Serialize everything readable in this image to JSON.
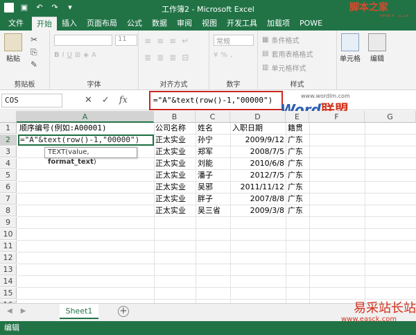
{
  "window": {
    "title": "工作簿2 - Microsoft Excel"
  },
  "watermarks": {
    "top_brand": "脚本之家",
    "top_url": "JB51.net",
    "word_url": "www.wordlm.com",
    "word_big": "Word",
    "word_big2": "联盟",
    "site": "易采站长站",
    "site_url": "www.easck.com"
  },
  "tabs": [
    "文件",
    "开始",
    "插入",
    "页面布局",
    "公式",
    "数据",
    "审阅",
    "视图",
    "开发工具",
    "加载项",
    "POWE"
  ],
  "ribbon": {
    "paste": "粘贴",
    "clipboard": "剪贴板",
    "font_size": "11",
    "font": "字体",
    "align": "对齐方式",
    "number_format": "常规",
    "number": "数字",
    "cond_format": "条件格式",
    "table_format": "套用表格格式",
    "cell_style": "单元格样式",
    "styles": "样式",
    "cells": "单元格",
    "edit": "编辑"
  },
  "formula_bar": {
    "name_box": "COS",
    "formula": "=\"A\"&text(row()-1,\"00000\")"
  },
  "columns": [
    "A",
    "B",
    "C",
    "D",
    "E",
    "F",
    "G"
  ],
  "rows": [
    "1",
    "2",
    "3",
    "4",
    "5",
    "6",
    "7",
    "8",
    "9",
    "10",
    "11",
    "12",
    "13",
    "14",
    "15",
    "16"
  ],
  "headers": {
    "a1": "顺序编号(例如:A00001)",
    "company": "公司名称",
    "name": "姓名",
    "date": "入职日期",
    "origin": "籍贯"
  },
  "data": [
    {
      "company": "正太实业",
      "name": "孙宁",
      "date": "2009/9/12",
      "origin": "广东"
    },
    {
      "company": "正太实业",
      "name": "郑军",
      "date": "2008/7/5",
      "origin": "广东"
    },
    {
      "company": "正太实业",
      "name": "刘能",
      "date": "2010/6/8",
      "origin": "广东"
    },
    {
      "company": "正太实业",
      "name": "潘子",
      "date": "2012/7/5",
      "origin": "广东"
    },
    {
      "company": "正太实业",
      "name": "吴邪",
      "date": "2011/11/12",
      "origin": "广东"
    },
    {
      "company": "正太实业",
      "name": "胖子",
      "date": "2007/8/8",
      "origin": "广东"
    },
    {
      "company": "正太实业",
      "name": "吴三省",
      "date": "2009/3/8",
      "origin": "广东"
    }
  ],
  "edit_cell": "=\"A\"&text(row()-1,\"00000\")",
  "tooltip": {
    "fn": "TEXT(value, ",
    "arg": "format_text",
    "end": ")"
  },
  "sheet": {
    "name": "Sheet1",
    "add": "+"
  },
  "status": "编辑"
}
